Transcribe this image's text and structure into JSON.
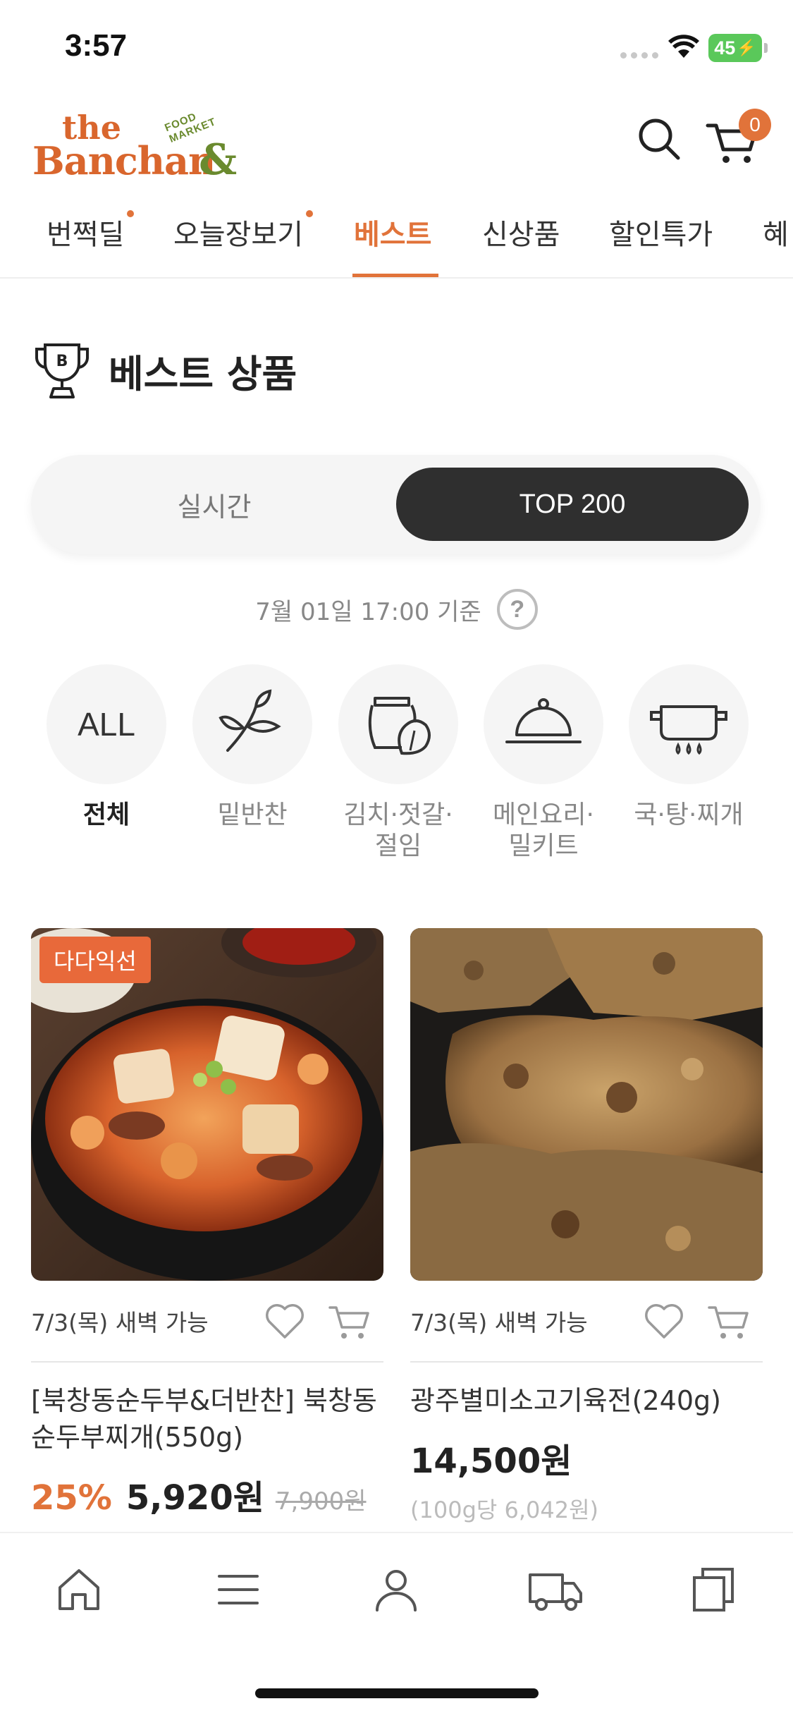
{
  "status_bar": {
    "time": "3:57",
    "battery": "45"
  },
  "header": {
    "logo": {
      "the": "the",
      "banchan": "Banchan",
      "amp": "&",
      "food_market": "FOOD MARKET"
    },
    "cart_count": "0",
    "icons": [
      "search-icon",
      "cart-icon"
    ]
  },
  "tabs": [
    {
      "label": "번쩍딜",
      "dot": true,
      "active": false
    },
    {
      "label": "오늘장보기",
      "dot": true,
      "active": false
    },
    {
      "label": "베스트",
      "dot": false,
      "active": true
    },
    {
      "label": "신상품",
      "dot": false,
      "active": false
    },
    {
      "label": "할인특가",
      "dot": false,
      "active": false
    },
    {
      "label": "혜",
      "dot": false,
      "active": false
    }
  ],
  "section": {
    "title": "베스트 상품",
    "trophy_letter": "B"
  },
  "segmented": {
    "realtime_label": "실시간",
    "top_label": "TOP 200",
    "selected": "TOP 200"
  },
  "basis": {
    "text": "7월 01일 17:00 기준",
    "help": "?"
  },
  "categories": [
    {
      "label": "전체",
      "icon": "all-text",
      "icon_text": "ALL",
      "active": true
    },
    {
      "label": "밑반찬",
      "icon": "leaf-icon",
      "active": false
    },
    {
      "label": "김치·젓갈·\n절임",
      "icon": "kimchi-jar-icon",
      "active": false
    },
    {
      "label": "메인요리·\n밀키트",
      "icon": "cloche-icon",
      "active": false
    },
    {
      "label": "국·탕·찌개",
      "icon": "pot-icon",
      "active": false
    }
  ],
  "products": [
    {
      "badge": "다다익선",
      "delivery": "7/3(목) 새벽 가능",
      "name": "[북창동순두부&더반찬] 북창동순두부찌개(550g)",
      "discount": "25%",
      "price": "5,920원",
      "original_price": "7,900원",
      "unit_price": ""
    },
    {
      "badge": "",
      "delivery": "7/3(목) 새벽 가능",
      "name": "광주별미소고기육전(240g)",
      "discount": "",
      "price": "14,500원",
      "original_price": "",
      "unit_price": "(100g당 6,042원)"
    }
  ],
  "bottom_nav": [
    "home-icon",
    "menu-icon",
    "user-icon",
    "delivery-truck-icon",
    "recent-view-icon"
  ],
  "colors": {
    "accent": "#e1733a",
    "logo_orange": "#d9662d",
    "logo_green": "#6a8a2e",
    "dark_button": "#2f2f2f"
  }
}
